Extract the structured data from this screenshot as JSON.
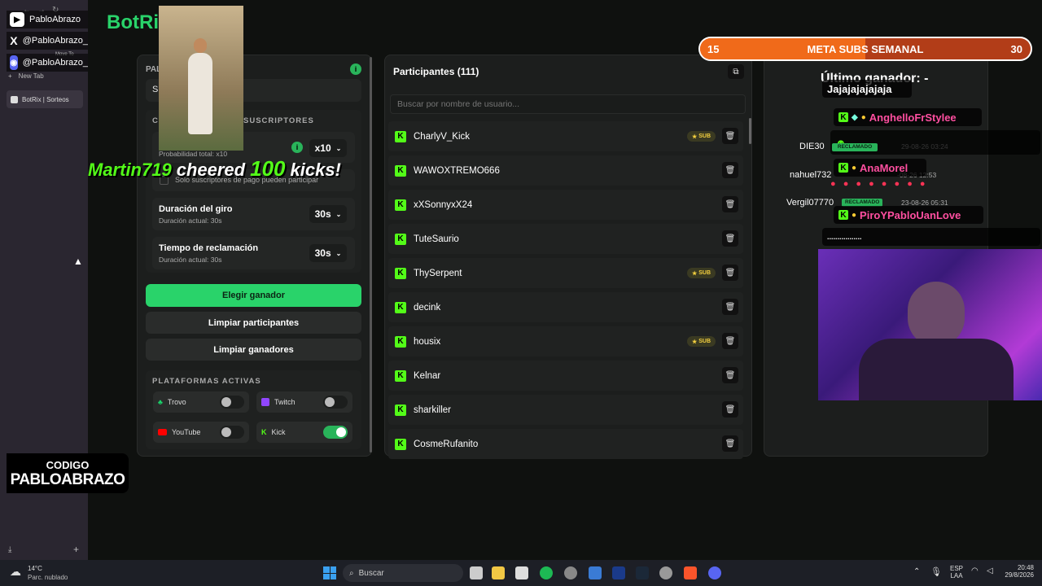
{
  "browser": {
    "new_tab_label": "New Tab",
    "move_to": "Move To",
    "active_tab": "BotRix | Sorteos"
  },
  "social": [
    {
      "icon": "youtube-icon",
      "handle": "PabloAbrazo"
    },
    {
      "icon": "x-icon",
      "handle": "@PabloAbrazo_"
    },
    {
      "icon": "discord-icon",
      "handle": "@PabloAbrazo_"
    }
  ],
  "app": {
    "brand": "BotRix"
  },
  "settings": {
    "header_fragment": "PAL",
    "search_fragment": "S",
    "subs_section": "SUSCRIPTORES",
    "subs_section_prefix": "CO",
    "subs_row_title_fragment": "es",
    "subs_prob": "Probabilidad total: x10",
    "subs_multiplier": "x10",
    "subs_only_note": "Solo suscriptores de pago pueden participar",
    "spin": {
      "title": "Duración del giro",
      "sub": "Duración actual: 30s",
      "value": "30s"
    },
    "claim": {
      "title": "Tiempo de reclamación",
      "sub": "Duración actual: 30s",
      "value": "30s"
    },
    "btn_pick": "Elegir ganador",
    "btn_clear_participants": "Limpiar participantes",
    "btn_clear_winners": "Limpiar ganadores",
    "platforms_title": "PLATAFORMAS ACTIVAS",
    "platforms": [
      {
        "name": "Trovo",
        "on": false
      },
      {
        "name": "Twitch",
        "on": false
      },
      {
        "name": "YouTube",
        "on": false
      },
      {
        "name": "Kick",
        "on": true
      }
    ]
  },
  "participants": {
    "title": "Participantes (111)",
    "search_placeholder": "Buscar por nombre de usuario...",
    "sub_badge": "SUB",
    "list": [
      {
        "name": "CharlyV_Kick",
        "sub": true
      },
      {
        "name": "WAWOXTREMO666",
        "sub": false
      },
      {
        "name": "xXSonnyxX24",
        "sub": false
      },
      {
        "name": "TuteSaurio",
        "sub": false
      },
      {
        "name": "ThySerpent",
        "sub": true
      },
      {
        "name": "decink",
        "sub": false
      },
      {
        "name": "housix",
        "sub": true
      },
      {
        "name": "Kelnar",
        "sub": false
      },
      {
        "name": "sharkiller",
        "sub": false
      },
      {
        "name": "CosmeRufanito",
        "sub": false
      }
    ]
  },
  "winners": {
    "title": "Último ganador: -",
    "claimed_label": "RECLAMADO",
    "rows": [
      {
        "name": "DIE30",
        "date": "29-08-26 03:24"
      },
      {
        "name": "nahuel732",
        "date": "-08-26 12:53"
      },
      {
        "name": "Vergil07770",
        "date": "23-08-26 05:31"
      }
    ]
  },
  "overlay": {
    "goal_left": "15",
    "goal_title": "META SUBS SEMANAL",
    "goal_right": "30",
    "cheer_user": "Martin719",
    "cheer_text": "cheered",
    "cheer_amount": "100",
    "cheer_unit": "kicks!",
    "code_label": "CODIGO",
    "code_value": "PABLOABRAZO",
    "goal_progress": 0.5
  },
  "chat": [
    {
      "user": "",
      "text": "Jajajajajajaja"
    },
    {
      "user": "AnghelloFrStylee",
      "text": ""
    },
    {
      "user": "AnaMorel",
      "text": ""
    },
    {
      "user": "PiroYPabloUanLove",
      "text": ""
    },
    {
      "user": "",
      "text": "................."
    }
  ],
  "taskbar": {
    "temp": "14°C",
    "weather": "Parc. nublado",
    "search": "Buscar",
    "lang": "ESP",
    "lang2": "LAA",
    "time": "20:48",
    "date": "29/8/2026"
  }
}
